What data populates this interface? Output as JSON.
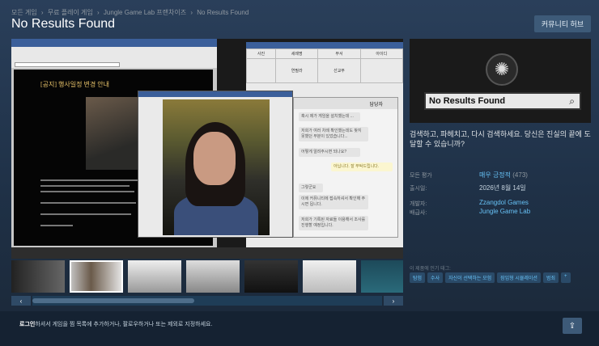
{
  "breadcrumb": [
    "모든 게임",
    "›",
    "무료 플레이 게임",
    "›",
    "Jungle Game Lab 프랜차이즈",
    "›",
    "No Results Found"
  ],
  "title": "No Results Found",
  "community_hub": "커뮤니티 허브",
  "screenshot": {
    "notice_title": "[공지] 행사일정 변경 안내",
    "chat_header": "담당자",
    "chat_messages": [
      "혹시 제가 게임을 설치했는데 ...",
      "저희가 여러 차례 확인했는데도 찾지 못했던 부분이 있었습니다...",
      "어떻게 알려주시면 되나요?",
      "아닙니다. 잘 부탁드립니다.",
      "그렇군요",
      "이에 커뮤니티에 접속하셔서 확인해 주시면 됩니다.",
      "저희가 기록된 자료들 이용해서 조사를 진행할 예정입니다."
    ],
    "table_headers": [
      "사진",
      "세례명",
      "부서",
      "아이디"
    ],
    "table_row": [
      "",
      "연필라",
      "선교부",
      ""
    ]
  },
  "capsule": {
    "title": "No Results Found"
  },
  "description": "검색하고, 파헤치고, 다시 검색하세요. 당신은 진실의 끝에 도달할 수 있습니까?",
  "reviews": {
    "label": "모든 평가",
    "value": "매우 긍정적",
    "count": "(473)"
  },
  "release": {
    "label": "출시일:",
    "value": "2026년 8월 14일"
  },
  "developer": {
    "label": "개발자:",
    "value": "Zzangdol Games"
  },
  "publisher": {
    "label": "배급사:",
    "value": "Jungle Game Lab"
  },
  "tags_label": "이 제품에 인기 태그:",
  "tags": [
    "탐험",
    "수사",
    "자신이 선택하는 모험",
    "잠입형 시뮬레이션",
    "범죄",
    "+"
  ],
  "footer": {
    "bold": "로그인",
    "rest": "하셔서 게임을 찜 목록에 추가하거나, 팔로우하거나 또는 제외로 지정하세요."
  },
  "icons": {
    "prev": "chevron-left-icon",
    "next": "chevron-right-icon",
    "share": "share-icon",
    "search": "search-icon"
  }
}
